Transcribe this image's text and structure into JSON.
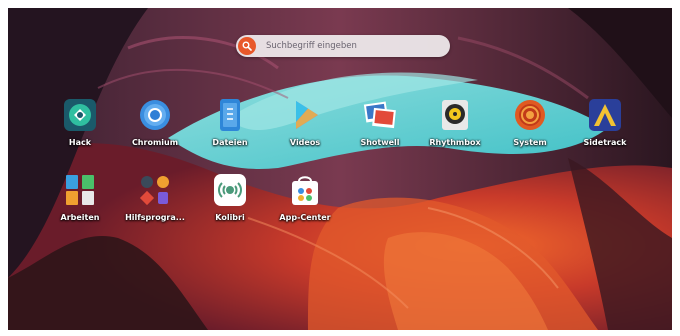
{
  "search": {
    "placeholder": "Suchbegriff eingeben",
    "icon": "search-icon"
  },
  "apps": [
    {
      "label": "Hack",
      "icon": "hack-icon"
    },
    {
      "label": "Chromium",
      "icon": "chromium-icon"
    },
    {
      "label": "Dateien",
      "icon": "files-icon"
    },
    {
      "label": "Videos",
      "icon": "videos-icon"
    },
    {
      "label": "Shotwell",
      "icon": "shotwell-icon"
    },
    {
      "label": "Rhythmbox",
      "icon": "rhythmbox-icon"
    },
    {
      "label": "System",
      "icon": "system-icon"
    },
    {
      "label": "Sidetrack",
      "icon": "sidetrack-icon"
    },
    {
      "label": "Arbeiten",
      "icon": "office-folder-icon"
    },
    {
      "label": "Hilfsprogra...",
      "icon": "utilities-folder-icon"
    },
    {
      "label": "Kolibri",
      "icon": "kolibri-icon"
    },
    {
      "label": "App-Center",
      "icon": "app-center-icon"
    }
  ],
  "colors": {
    "accent": "#e8582a",
    "sky": "#4fc9c8",
    "rock": "#d8482a"
  }
}
